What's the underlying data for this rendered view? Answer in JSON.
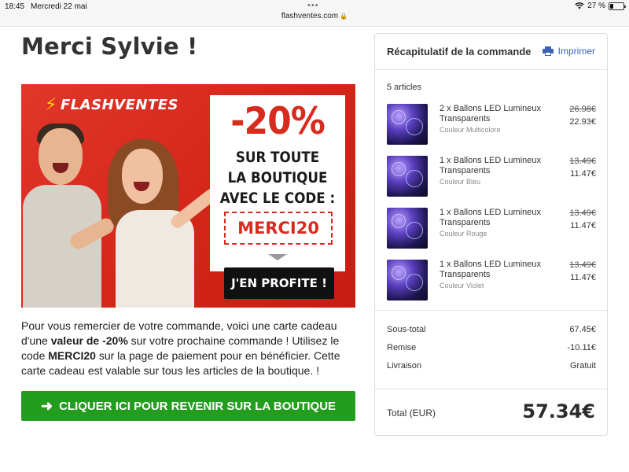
{
  "status_bar": {
    "time": "18:45",
    "date": "Mercredi 22 mai",
    "url": "flashventes.com",
    "battery": "27 %",
    "battery_level": 0.27
  },
  "page": {
    "title": "Merci Sylvie !"
  },
  "banner": {
    "logo": "FLASHVENTES",
    "discount": "-20%",
    "line1": "SUR TOUTE",
    "line2": "LA BOUTIQUE",
    "line3": "AVEC LE CODE :",
    "code": "MERCI20",
    "cta": "J'EN PROFITE !"
  },
  "message": {
    "p1": "Pour vous remercier de votre commande, voici une carte cadeau d'une",
    "bold1": "valeur de -20%",
    "p2": " sur votre prochaine commande ! Utilisez le code ",
    "bold2": "MERCI20",
    "p3": " sur la page de paiement pour en bénéficier. Cette carte cadeau est valable sur tous les articles de la boutique. !"
  },
  "return_button": {
    "label": "CLIQUER ICI POUR REVENIR SUR LA BOUTIQUE"
  },
  "summary": {
    "title": "Récapitulatif de la commande",
    "print_label": "Imprimer",
    "count": "5 articles",
    "items": [
      {
        "name": "2 x Ballons LED Lumineux Transparents",
        "variant": "Couleur Multicolore",
        "old_price": "26.98€",
        "price": "22.93€"
      },
      {
        "name": "1 x Ballons LED Lumineux Transparents",
        "variant": "Couleur Bleu",
        "old_price": "13.49€",
        "price": "11.47€"
      },
      {
        "name": "1 x Ballons LED Lumineux Transparents",
        "variant": "Couleur Rouge",
        "old_price": "13.49€",
        "price": "11.47€"
      },
      {
        "name": "1 x Ballons LED Lumineux Transparents",
        "variant": "Couleur Violet",
        "old_price": "13.49€",
        "price": "11.47€"
      }
    ],
    "subtotal_label": "Sous-total",
    "subtotal": "67.45€",
    "discount_label": "Remise",
    "discount": "-10.11€",
    "shipping_label": "Livraison",
    "shipping": "Gratuit",
    "total_label": "Total (EUR)",
    "total": "57.34€"
  },
  "colors": {
    "brand_red": "#d72b1e",
    "cta_green": "#239d1e",
    "link_blue": "#3b62b8"
  }
}
